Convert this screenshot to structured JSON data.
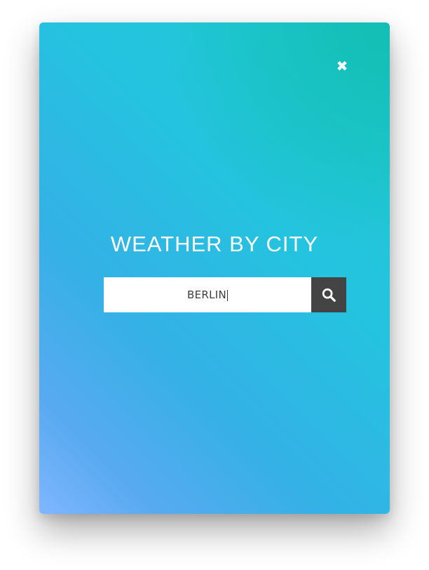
{
  "app": {
    "title": "WEATHER BY CITY"
  },
  "search": {
    "value": "BERLIN",
    "placeholder": ""
  },
  "icons": {
    "close": "close-icon",
    "search": "search-icon"
  },
  "colors": {
    "gradient_bottom_left": "#7fb6ff",
    "gradient_center": "#24c3df",
    "gradient_top_right": "#12beb0",
    "button_background": "#444444",
    "input_background": "#ffffff"
  }
}
